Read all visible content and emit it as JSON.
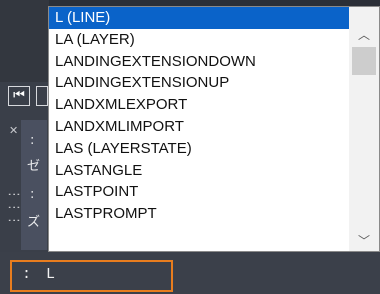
{
  "autocomplete": {
    "items": [
      {
        "label": "L (LINE)",
        "selected": true
      },
      {
        "label": "LA (LAYER)",
        "selected": false
      },
      {
        "label": "LANDINGEXTENSIONDOWN",
        "selected": false
      },
      {
        "label": "LANDINGEXTENSIONUP",
        "selected": false
      },
      {
        "label": "LANDXMLEXPORT",
        "selected": false
      },
      {
        "label": "LANDXMLIMPORT",
        "selected": false
      },
      {
        "label": "LAS (LAYERSTATE)",
        "selected": false
      },
      {
        "label": "LASTANGLE",
        "selected": false
      },
      {
        "label": "LASTPOINT",
        "selected": false
      },
      {
        "label": "LASTPROMPT",
        "selected": false
      }
    ],
    "scroll_up_icon": "chevron-up-icon",
    "scroll_down_icon": "chevron-down-icon"
  },
  "command_line": {
    "prompt": ":",
    "value": "L",
    "accent_color": "#e87d1e"
  },
  "side_panel": {
    "collapse_icon": "skip-back-icon",
    "close_icon": "close-icon",
    "grip_icon": "grip-icon"
  },
  "colors": {
    "selection": "#0a63c9",
    "background": "#2b2f37"
  }
}
